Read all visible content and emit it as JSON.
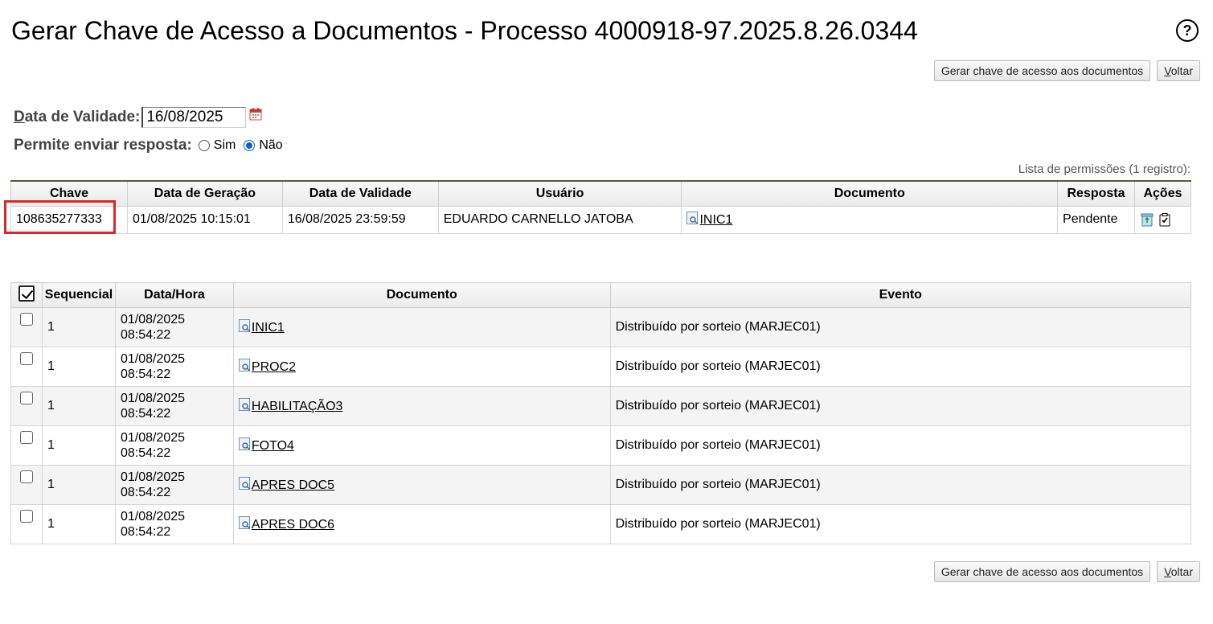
{
  "page": {
    "title": "Gerar Chave de Acesso a Documentos - Processo 4000918-97.2025.8.26.0344",
    "help_icon": "question-circle-icon"
  },
  "buttons": {
    "generate": "Gerar chave de acesso aos documentos",
    "back": "Voltar"
  },
  "form": {
    "validity_label": "Data de Validade:",
    "validity_value": "16/08/2025",
    "reply_label": "Permite enviar resposta:",
    "reply_options": [
      "Sim",
      "Não"
    ],
    "reply_selected": "Não"
  },
  "permissions": {
    "caption": "Lista de permissões (1 registro):",
    "headers": [
      "Chave",
      "Data de Geração",
      "Data de Validade",
      "Usuário",
      "Documento",
      "Resposta",
      "Ações"
    ],
    "rows": [
      {
        "key": "108635277333",
        "generated": "01/08/2025 10:15:01",
        "valid_until": "16/08/2025 23:59:59",
        "user": "EDUARDO CARNELLO JATOBA",
        "document": "INIC1",
        "reply": "Pendente"
      }
    ],
    "highlight_color": "#d9272e"
  },
  "documents": {
    "headers": [
      "Sequencial",
      "Data/Hora",
      "Documento",
      "Evento"
    ],
    "rows": [
      {
        "seq": "1",
        "date": "01/08/2025",
        "time": "08:54:22",
        "doc": "INIC1",
        "event": "Distribuído por sorteio (MARJEC01)"
      },
      {
        "seq": "1",
        "date": "01/08/2025",
        "time": "08:54:22",
        "doc": "PROC2",
        "event": "Distribuído por sorteio (MARJEC01)"
      },
      {
        "seq": "1",
        "date": "01/08/2025",
        "time": "08:54:22",
        "doc": "HABILITAÇÃO3",
        "event": "Distribuído por sorteio (MARJEC01)"
      },
      {
        "seq": "1",
        "date": "01/08/2025",
        "time": "08:54:22",
        "doc": "FOTO4",
        "event": "Distribuído por sorteio (MARJEC01)"
      },
      {
        "seq": "1",
        "date": "01/08/2025",
        "time": "08:54:22",
        "doc": "APRES DOC5",
        "event": "Distribuído por sorteio (MARJEC01)"
      },
      {
        "seq": "1",
        "date": "01/08/2025",
        "time": "08:54:22",
        "doc": "APRES DOC6",
        "event": "Distribuído por sorteio (MARJEC01)"
      }
    ]
  }
}
